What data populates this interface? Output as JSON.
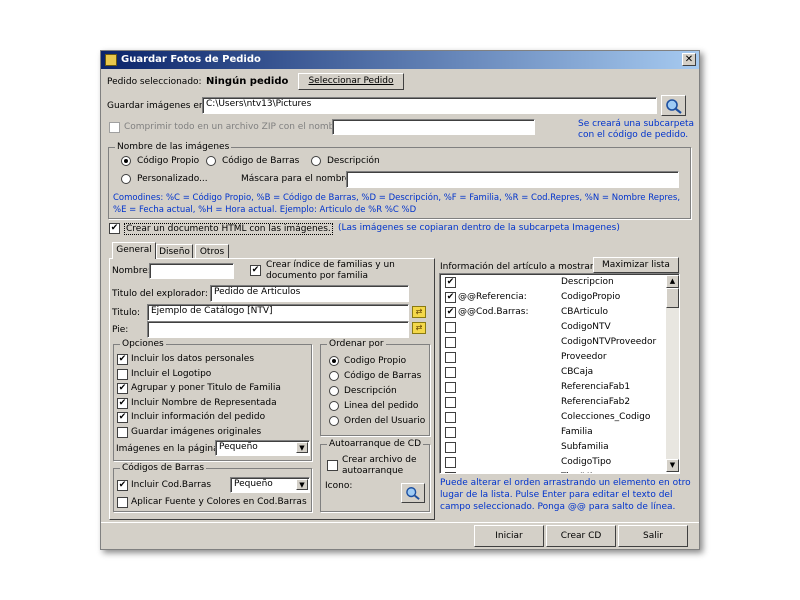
{
  "window": {
    "title": "Guardar Fotos de Pedido",
    "close_label": "✕"
  },
  "pedido": {
    "label": "Pedido seleccionado:",
    "value": "Ningún pedido",
    "select_button": "Seleccionar Pedido"
  },
  "guardar": {
    "label": "Guardar imágenes en:",
    "path": "C:\\Users\\ntv13\\Pictures"
  },
  "zip": {
    "label": "Comprimir todo en un archivo ZIP con el nombre:",
    "value": "",
    "checked": false
  },
  "subcarpeta_note": {
    "line1": "Se creará una subcarpeta",
    "line2": "con el código de pedido."
  },
  "nombre_imagenes": {
    "group_label": "Nombre de las imágenes",
    "options": [
      "Código Propio",
      "Código de Barras",
      "Descripción",
      "Personalizado..."
    ],
    "selected": "Código Propio",
    "mascara_label": "Máscara para el nombre:",
    "mascara_value": "",
    "comodines_line1": "Comodines: %C = Código Propio, %B = Código de Barras, %D = Descripción, %F = Familia, %R = Cod.Repres,  %N = Nombre Repres,",
    "comodines_line2": "%E = Fecha actual, %H = Hora actual.   Ejemplo: Articulo de %R %C %D"
  },
  "html_doc": {
    "label": "Crear un documento HTML con las imágenes.",
    "checked": true,
    "note": "(Las imágenes se copiaran dentro de la subcarpeta Imagenes)"
  },
  "tabs": [
    "General",
    "Diseño",
    "Otros"
  ],
  "general": {
    "nombre_label": "Nombre:",
    "nombre_value": "",
    "indice_label_1": "Crear índice de familias y un",
    "indice_label_2": "documento por familia",
    "indice_checked": true,
    "titulo_explorador_label": "Titulo del explorador:",
    "titulo_explorador_value": "Pedido de Articulos",
    "titulo_label": "Titulo:",
    "titulo_value": "Ejemplo de Catálogo [NTV]",
    "pie_label": "Pie:",
    "pie_value": ""
  },
  "opciones": {
    "group_label": "Opciones",
    "items": [
      {
        "label": "Incluir los datos personales",
        "checked": true
      },
      {
        "label": "Incluir el Logotipo",
        "checked": false
      },
      {
        "label": "Agrupar y poner Titulo de Familia",
        "checked": true
      },
      {
        "label": "Incluir Nombre de Representada",
        "checked": true
      },
      {
        "label": "Incluir información del pedido",
        "checked": true
      },
      {
        "label": "Guardar imágenes originales",
        "checked": false
      }
    ],
    "imagenes_label": "Imágenes en la página:",
    "imagenes_value": "Pequeño"
  },
  "ordenar": {
    "group_label": "Ordenar por",
    "options": [
      "Codigo Propio",
      "Código de Barras",
      "Descripción",
      "Linea del pedido",
      "Orden del Usuario"
    ],
    "selected": "Codigo Propio"
  },
  "codigos_barras": {
    "group_label": "Códigos de Barras",
    "incluir_label": "Incluir Cod.Barras",
    "incluir_checked": true,
    "size_value": "Pequeño",
    "aplicar_label": "Aplicar Fuente y Colores en Cod.Barras",
    "aplicar_checked": false
  },
  "autoarranque": {
    "group_label": "Autoarranque de CD",
    "crear_label_1": "Crear archivo de",
    "crear_label_2": "autoarranque",
    "checked": false,
    "icono_label": "Icono:"
  },
  "info_articulo": {
    "label": "Información del artículo a mostrar",
    "maximize_button": "Maximizar lista",
    "rows": [
      {
        "checked": true,
        "prefix": "",
        "field": "Descripcion"
      },
      {
        "checked": true,
        "prefix": "@@Referencia:",
        "field": "CodigoPropio"
      },
      {
        "checked": true,
        "prefix": "@@Cod.Barras:",
        "field": "CBArticulo"
      },
      {
        "checked": false,
        "prefix": "",
        "field": "CodigoNTV"
      },
      {
        "checked": false,
        "prefix": "",
        "field": "CodigoNTVProveedor"
      },
      {
        "checked": false,
        "prefix": "",
        "field": "Proveedor"
      },
      {
        "checked": false,
        "prefix": "",
        "field": "CBCaja"
      },
      {
        "checked": false,
        "prefix": "",
        "field": "ReferenciaFab1"
      },
      {
        "checked": false,
        "prefix": "",
        "field": "ReferenciaFab2"
      },
      {
        "checked": false,
        "prefix": "",
        "field": "Colecciones_Codigo"
      },
      {
        "checked": false,
        "prefix": "",
        "field": "Familia"
      },
      {
        "checked": false,
        "prefix": "",
        "field": "Subfamilia"
      },
      {
        "checked": false,
        "prefix": "",
        "field": "CodigoTipo"
      },
      {
        "checked": false,
        "prefix": "",
        "field": "TipoIVA"
      }
    ],
    "help_1": "Puede alterar el orden arrastrando un elemento en otro",
    "help_2": "lugar de la lista. Pulse Enter para editar el texto del",
    "help_3": "campo seleccionado. Ponga @@ para salto de línea."
  },
  "footer": {
    "iniciar": "Iniciar",
    "crear_cd": "Crear CD",
    "salir": "Salir"
  },
  "colors": {
    "titlebar_start": "#0a246a",
    "titlebar_end": "#a6caf0",
    "face": "#d4d0c8",
    "info_blue": "#0033cc"
  }
}
